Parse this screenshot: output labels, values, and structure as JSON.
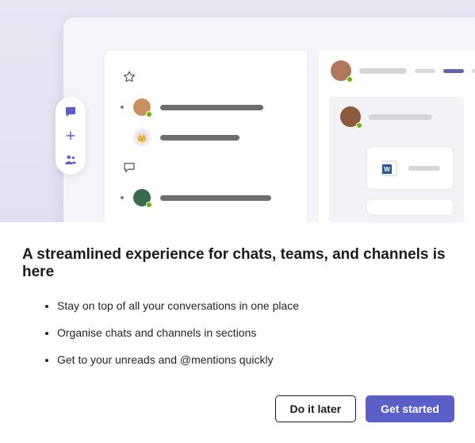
{
  "headline": "A streamlined experience for chats, teams, and channels is here",
  "bullets": [
    "Stay on top of all your conversations in one place",
    "Organise chats and channels in sections",
    "Get to your unreads and @mentions quickly"
  ],
  "actions": {
    "later": "Do it later",
    "start": "Get started"
  },
  "illustration": {
    "nav": {
      "chat": "chat-icon",
      "add": "plus-icon",
      "people": "people-icon"
    },
    "list_icons": {
      "star": "star-icon",
      "bubble": "speech-bubble-icon",
      "team": "teams-icon"
    },
    "file_icon": "word-doc-icon"
  },
  "colors": {
    "brand": "#5b5fc7",
    "hero_bg": "#e8e5f5"
  }
}
